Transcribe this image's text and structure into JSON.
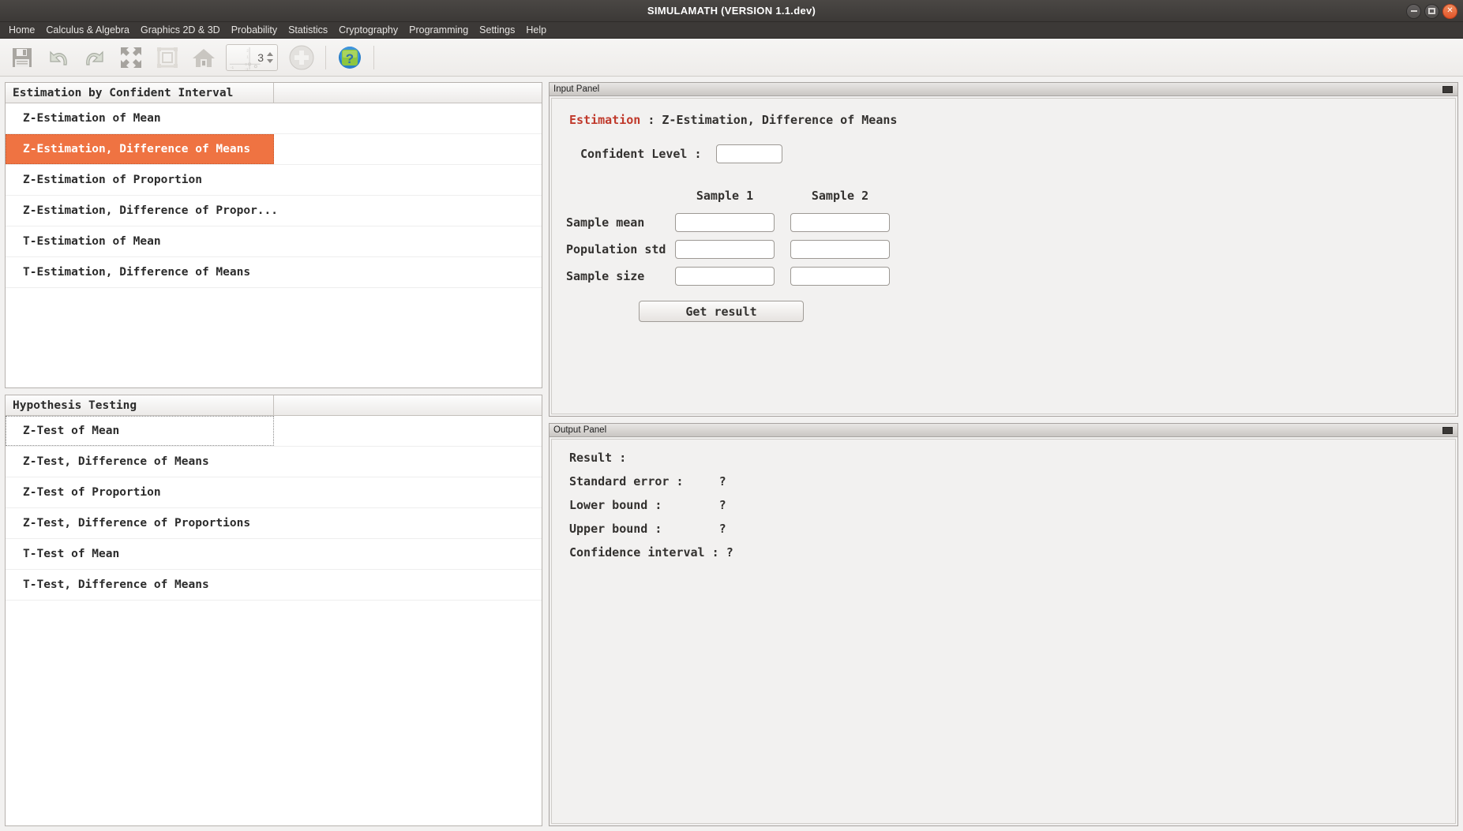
{
  "window": {
    "title": "SIMULAMATH  (VERSION 1.1.dev)",
    "controls": [
      {
        "name": "minimize-window-button",
        "glyph": "bar"
      },
      {
        "name": "maximize-window-button",
        "glyph": "square"
      },
      {
        "name": "close-window-button",
        "glyph": "×"
      }
    ],
    "close_color": "#e2552a"
  },
  "menubar": {
    "items": [
      {
        "label": "Home"
      },
      {
        "label": "Calculus & Algebra"
      },
      {
        "label": "Graphics 2D & 3D"
      },
      {
        "label": "Probability"
      },
      {
        "label": "Statistics"
      },
      {
        "label": "Cryptography"
      },
      {
        "label": "Programming"
      },
      {
        "label": "Settings"
      },
      {
        "label": "Help"
      }
    ]
  },
  "toolbar": {
    "buttons": [
      {
        "name": "save-icon",
        "title": "Save"
      },
      {
        "name": "undo-icon",
        "title": "Undo"
      },
      {
        "name": "redo-icon",
        "title": "Redo"
      },
      {
        "name": "fullscreen-icon",
        "title": "Fullscreen"
      },
      {
        "name": "fit-selection-icon",
        "title": "Fit selection"
      },
      {
        "name": "home-icon",
        "title": "Home"
      }
    ],
    "spinner": {
      "value": "3"
    },
    "zoom_in": {
      "name": "zoom-in-icon",
      "title": "Zoom in"
    },
    "help": {
      "name": "help-icon",
      "title": "Help",
      "glyph": "?"
    }
  },
  "estimation_list": {
    "header": "Estimation by Confident Interval",
    "selected_index": 1,
    "items": [
      {
        "label": "Z-Estimation of Mean"
      },
      {
        "label": "Z-Estimation, Difference of Means"
      },
      {
        "label": "Z-Estimation of Proportion"
      },
      {
        "label": "Z-Estimation, Difference of Propor..."
      },
      {
        "label": "T-Estimation of Mean"
      },
      {
        "label": "T-Estimation, Difference of Means"
      }
    ]
  },
  "hypothesis_list": {
    "header": "Hypothesis Testing",
    "focused_index": 0,
    "items": [
      {
        "label": "Z-Test of Mean"
      },
      {
        "label": "Z-Test, Difference of Means"
      },
      {
        "label": "Z-Test of Proportion"
      },
      {
        "label": "Z-Test, Difference of Proportions"
      },
      {
        "label": "T-Test of Mean"
      },
      {
        "label": "T-Test, Difference of Means"
      }
    ]
  },
  "input_panel": {
    "header": "Input Panel",
    "title_keyword": "Estimation",
    "title_rest": " : Z-Estimation, Difference of Means",
    "keyword_color": "#c0392b",
    "confident_level_label": "Confident Level :",
    "confident_level_value": "",
    "column_headers": [
      "Sample 1",
      "Sample 2"
    ],
    "rows": [
      {
        "label": "Sample mean",
        "sample1": "",
        "sample2": ""
      },
      {
        "label": "Population std",
        "sample1": "",
        "sample2": ""
      },
      {
        "label": "Sample size",
        "sample1": "",
        "sample2": ""
      }
    ],
    "submit_label": "Get result"
  },
  "output_panel": {
    "header": "Output Panel",
    "result_label": "Result :",
    "lines": [
      {
        "key": "Standard error :     ",
        "value": "?"
      },
      {
        "key": "Lower bound :        ",
        "value": "?"
      },
      {
        "key": "Upper bound :        ",
        "value": "?"
      },
      {
        "key": "Confidence interval : ",
        "value": "?"
      }
    ]
  }
}
